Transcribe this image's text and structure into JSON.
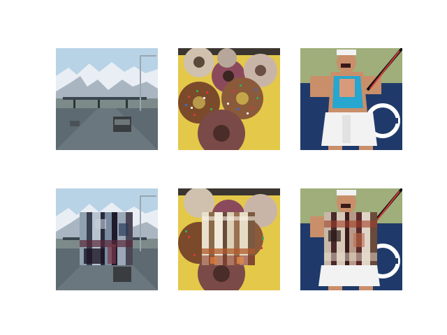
{
  "figure": {
    "grid": "2x3",
    "rows": [
      {
        "row": "original",
        "images": [
          {
            "subject": "highway-snowy-mountains"
          },
          {
            "subject": "sprinkled-donuts-plate"
          },
          {
            "subject": "tennis-player-swing"
          }
        ]
      },
      {
        "row": "with-center-patch",
        "images": [
          {
            "subject": "highway-snowy-mountains",
            "patch": "glitch-texture-dark"
          },
          {
            "subject": "sprinkled-donuts-plate",
            "patch": "glitch-texture-light"
          },
          {
            "subject": "tennis-player-swing",
            "patch": "glitch-texture-dark"
          }
        ]
      }
    ]
  },
  "palette": {
    "background": "#ffffff",
    "sky": "#b9d3e6",
    "snow": "#e9eef4",
    "road": "#5d6a72",
    "plate": "#e4c84a",
    "donut_glaze": "#a77a84",
    "court_blue": "#1f3a6a",
    "shirt_cyan": "#27a6cf"
  }
}
